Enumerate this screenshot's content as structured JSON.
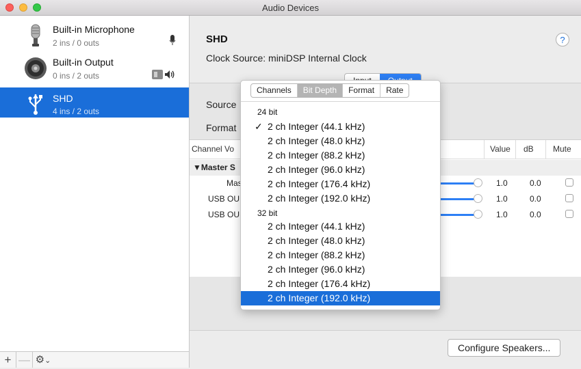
{
  "window": {
    "title": "Audio Devices"
  },
  "sidebar": {
    "devices": [
      {
        "name": "Built-in Microphone",
        "io": "2 ins / 0 outs",
        "icon": "microphone-icon"
      },
      {
        "name": "Built-in Output",
        "io": "0 ins / 2 outs",
        "icon": "speaker-icon"
      },
      {
        "name": "SHD",
        "io": "4 ins / 2 outs",
        "icon": "usb-icon",
        "selected": true
      }
    ],
    "footer": {
      "add": "+",
      "remove": "—",
      "gear": "⚙",
      "gear_chevron": "⌄"
    }
  },
  "main": {
    "device_name": "SHD",
    "clock_source": "Clock Source:  miniDSP Internal Clock",
    "help": "?",
    "io_tabs": [
      "Input",
      "Output"
    ],
    "source_label": "Source",
    "format_label": "Format",
    "channel_header": "Channel Vo",
    "columns": {
      "value": "Value",
      "db": "dB",
      "mute": "Mute"
    },
    "rows": [
      {
        "label": "▼Master S",
        "value": "",
        "db": "",
        "group": true
      },
      {
        "label": "Mas",
        "value": "1.0",
        "db": "0.0"
      },
      {
        "label": "USB OU",
        "value": "1.0",
        "db": "0.0"
      },
      {
        "label": "USB OU",
        "value": "1.0",
        "db": "0.0"
      }
    ],
    "configure_button": "Configure Speakers..."
  },
  "popover": {
    "tabs": [
      "Channels",
      "Bit Depth",
      "Format",
      "Rate"
    ],
    "active_tab": "Bit Depth",
    "check_mark": "✓",
    "groups": [
      {
        "heading": "24 bit",
        "items": [
          "2 ch Integer (44.1 kHz)",
          "2 ch Integer (48.0 kHz)",
          "2 ch Integer (88.2 kHz)",
          "2 ch Integer (96.0 kHz)",
          "2 ch Integer (176.4 kHz)",
          "2 ch Integer (192.0 kHz)"
        ]
      },
      {
        "heading": "32 bit",
        "items": [
          "2 ch Integer (44.1 kHz)",
          "2 ch Integer (48.0 kHz)",
          "2 ch Integer (88.2 kHz)",
          "2 ch Integer (96.0 kHz)",
          "2 ch Integer (176.4 kHz)",
          "2 ch Integer (192.0 kHz)"
        ]
      }
    ],
    "checked_item": "2 ch Integer (44.1 kHz)",
    "highlighted_item": "2 ch Integer (192.0 kHz)"
  },
  "colors": {
    "selection": "#1a6ed9",
    "accent": "#2d7ff5"
  }
}
